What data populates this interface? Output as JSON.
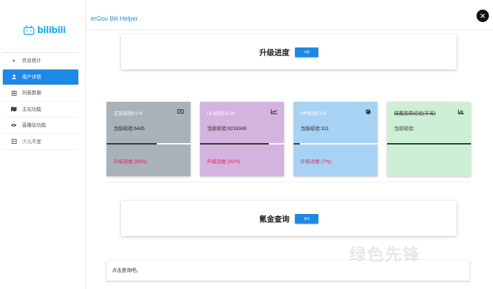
{
  "app": {
    "logo_text": "bilibili",
    "title": "erGou Bili Helper"
  },
  "sidebar": {
    "items": [
      {
        "label": "信息统计",
        "icon": "pie-icon",
        "active": false
      },
      {
        "label": "用户详情",
        "icon": "user-icon",
        "active": true
      },
      {
        "label": "列表数据",
        "icon": "table-icon",
        "active": false
      },
      {
        "label": "主站功能",
        "icon": "map-icon",
        "active": false
      },
      {
        "label": "直播站功能",
        "icon": "eye-icon",
        "active": false
      },
      {
        "label": "少儿不宜",
        "icon": "minus-square-icon",
        "active": false
      }
    ]
  },
  "upgrade_panel": {
    "title": "升级进度",
    "button": "详细"
  },
  "cards": [
    {
      "title": "主站经验LV:4",
      "value": "当前经验:6445",
      "progress_label": "升级进度 (60%)",
      "progress": 0.6,
      "bg": "#a9b1b9",
      "icon": "money-icon",
      "strike": false
    },
    {
      "title": "UL经验LV:25",
      "value": "当前经验:8233349",
      "progress_label": "升级进度 (82%)",
      "progress": 0.82,
      "bg": "#d4b3df",
      "icon": "line-chart-icon",
      "strike": false
    },
    {
      "title": "UP经验LV:8",
      "value": "当前经验:311",
      "progress_label": "升级进度 (7%)",
      "progress": 0.07,
      "bg": "#a7d2f3",
      "icon": "pie-chart-icon",
      "strike": false
    },
    {
      "title": "佩戴勋章经验(不写)",
      "value": "当前经验:",
      "progress_label": "",
      "progress": 1.0,
      "bg": "#cdefd6",
      "icon": "bar-chart-icon",
      "strike": true
    }
  ],
  "gold_panel": {
    "title": "氪金查询",
    "button": "查询"
  },
  "result": {
    "text": "点击查询吧。"
  },
  "watermark": "绿色先锋"
}
